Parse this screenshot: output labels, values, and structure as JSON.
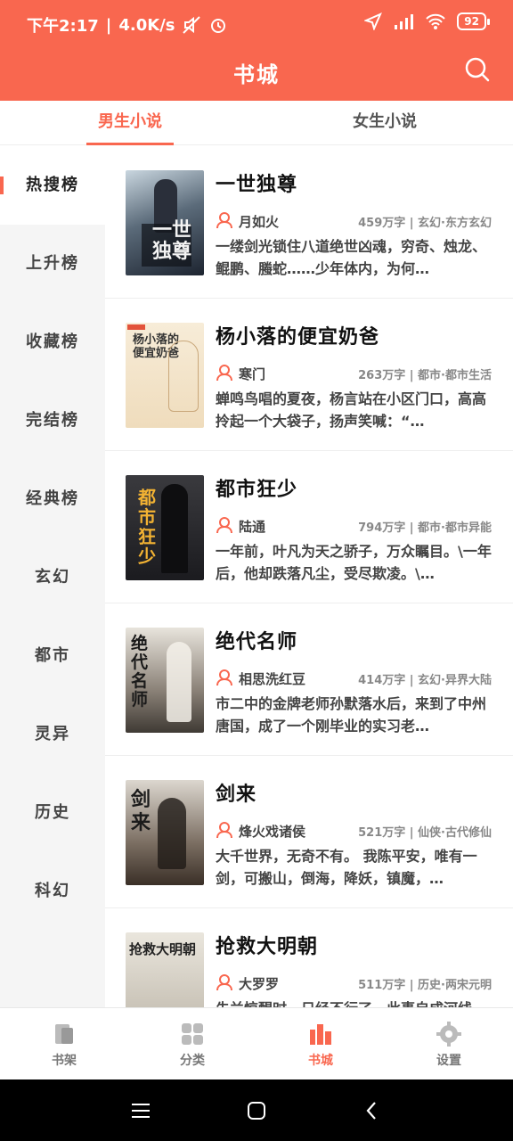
{
  "status_bar": {
    "time": "下午2:17",
    "net_speed": "4.0K/s",
    "battery": "92"
  },
  "header": {
    "title": "书城"
  },
  "gender_tabs": [
    {
      "label": "男生小说",
      "active": true
    },
    {
      "label": "女生小说",
      "active": false
    }
  ],
  "sidebar": {
    "items": [
      {
        "label": "热搜榜",
        "active": true
      },
      {
        "label": "上升榜"
      },
      {
        "label": "收藏榜"
      },
      {
        "label": "完结榜"
      },
      {
        "label": "经典榜"
      },
      {
        "label": "玄幻"
      },
      {
        "label": "都市"
      },
      {
        "label": "灵异"
      },
      {
        "label": "历史"
      },
      {
        "label": "科幻"
      }
    ]
  },
  "books": [
    {
      "title": "一世独尊",
      "author": "月如火",
      "stats": "459万字 | 玄幻·东方玄幻",
      "desc": "一缕剑光锁住八道绝世凶魂，穷奇、烛龙、鲲鹏、螣蛇……少年体内，为何…",
      "cover_text": "一世独尊"
    },
    {
      "title": "杨小落的便宜奶爸",
      "author": "寒门",
      "stats": "263万字 | 都市·都市生活",
      "desc": "蝉鸣鸟唱的夏夜，杨言站在小区门口，高高拎起一个大袋子，扬声笑喊：“…",
      "cover_text": "杨小落的便宜奶爸"
    },
    {
      "title": "都市狂少",
      "author": "陆通",
      "stats": "794万字 | 都市·都市异能",
      "desc": "一年前，叶凡为天之骄子，万众瞩目。\\一年后，他却跌落凡尘，受尽欺凌。\\…",
      "cover_text": "都市狂少"
    },
    {
      "title": "绝代名师",
      "author": "相思洗红豆",
      "stats": "414万字 | 玄幻·异界大陆",
      "desc": "市二中的金牌老师孙默落水后，来到了中州唐国，成了一个刚毕业的实习老…",
      "cover_text": "绝代名师"
    },
    {
      "title": "剑来",
      "author": "烽火戏诸侯",
      "stats": "521万字 | 仙侠·古代修仙",
      "desc": "大千世界，无奇不有。 我陈平安，唯有一剑，可搬山，倒海，降妖，镇魔，…",
      "cover_text": "剑来"
    },
    {
      "title": "抢救大明朝",
      "author": "大罗罗",
      "stats": "511万字 | 历史·两宋元明",
      "desc": "朱兰惊醒时，日经不行了，此事自成河线",
      "cover_text": "抢救大明朝"
    }
  ],
  "bottom_nav": [
    {
      "label": "书架",
      "icon": "bookshelf-icon"
    },
    {
      "label": "分类",
      "icon": "category-icon"
    },
    {
      "label": "书城",
      "icon": "bookstore-icon",
      "active": true
    },
    {
      "label": "设置",
      "icon": "gear-icon"
    }
  ],
  "colors": {
    "accent": "#f9674f",
    "sidebar_bg": "#f5f5f5"
  }
}
